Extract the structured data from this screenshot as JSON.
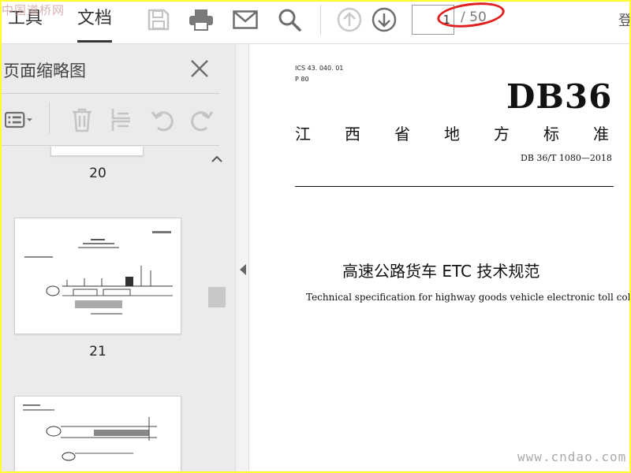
{
  "watermark_top": "中国道桥网",
  "watermark_bottom": "www.cndao.com",
  "toolbar": {
    "tab_tools": "工具",
    "tab_document": "文档",
    "page_current": "1",
    "page_total": "/ 50",
    "top_right_glyph": "登"
  },
  "sidebar": {
    "title": "页面缩略图",
    "thumbnails": [
      {
        "label": "20"
      },
      {
        "label": "21"
      }
    ]
  },
  "document": {
    "ics": "ICS   43. 040. 01",
    "p_code": "P  80",
    "standard_code": "DB36",
    "province_chars": [
      "江",
      "西",
      "省",
      "地",
      "方",
      "标",
      "准"
    ],
    "standard_number": "DB 36/T  1080—2018",
    "title_cn": "高速公路货车 ETC 技术规范",
    "title_en": "Technical specification for highway goods vehicle electronic toll collection"
  },
  "colors": {
    "frame_border": "#ffff33",
    "annotation_oval": "#e02020",
    "sidebar_bg": "#ebebeb"
  }
}
